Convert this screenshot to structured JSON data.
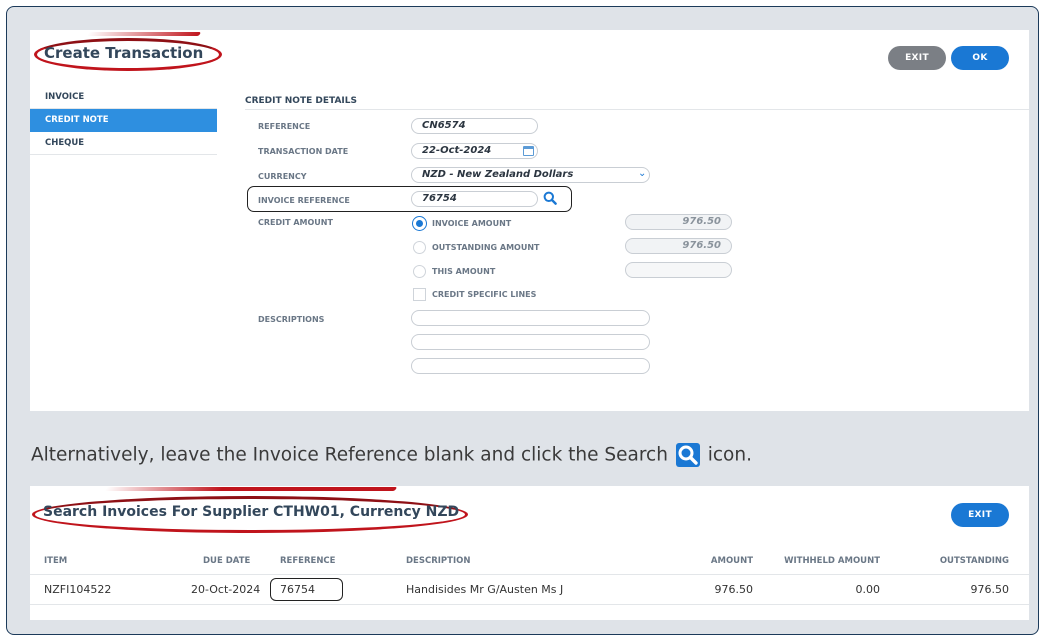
{
  "create_panel": {
    "title": "Create Transaction",
    "exit_label": "EXIT",
    "ok_label": "OK",
    "sidebar": [
      {
        "label": "INVOICE",
        "active": false
      },
      {
        "label": "CREDIT NOTE",
        "active": true
      },
      {
        "label": "CHEQUE",
        "active": false
      }
    ],
    "section_title": "CREDIT NOTE DETAILS",
    "fields": {
      "reference": {
        "label": "REFERENCE",
        "value": "CN6574"
      },
      "transaction_date": {
        "label": "TRANSACTION DATE",
        "value": "22-Oct-2024"
      },
      "currency": {
        "label": "CURRENCY",
        "value": "NZD - New Zealand Dollars"
      },
      "invoice_reference": {
        "label": "INVOICE REFERENCE",
        "value": "76754"
      },
      "credit_amount": {
        "label": "CREDIT AMOUNT",
        "options": [
          {
            "label": "INVOICE AMOUNT",
            "value": "976.50",
            "selected": true
          },
          {
            "label": "OUTSTANDING AMOUNT",
            "value": "976.50",
            "selected": false
          },
          {
            "label": "THIS AMOUNT",
            "value": "",
            "selected": false
          }
        ],
        "specific_lines_label": "CREDIT SPECIFIC LINES"
      },
      "descriptions": {
        "label": "DESCRIPTIONS",
        "values": [
          "",
          "",
          ""
        ]
      }
    }
  },
  "caption": {
    "before": "Alternatively, leave the Invoice Reference blank and click the Search",
    "after": "icon."
  },
  "search_panel": {
    "title": "Search Invoices For Supplier CTHW01, Currency NZD",
    "exit_label": "EXIT",
    "columns": [
      "ITEM",
      "DUE DATE",
      "REFERENCE",
      "DESCRIPTION",
      "AMOUNT",
      "WITHHELD AMOUNT",
      "OUTSTANDING"
    ],
    "rows": [
      {
        "item": "NZFI104522",
        "due_date": "20-Oct-2024",
        "reference": "76754",
        "description": "Handisides Mr G/Austen Ms J",
        "amount": "976.50",
        "withheld": "0.00",
        "outstanding": "976.50"
      }
    ]
  },
  "colors": {
    "accent": "#1a78d4",
    "annotation": "#c0141c",
    "frame_border": "#1c3a5a"
  },
  "icons": {
    "search": "search-icon",
    "calendar": "calendar-icon",
    "dropdown": "chevron-down-icon"
  }
}
